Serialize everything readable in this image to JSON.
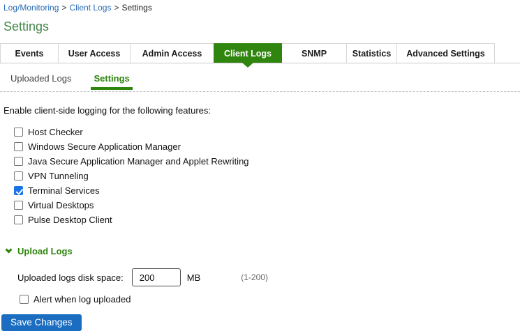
{
  "breadcrumb": {
    "separator": ">",
    "items": [
      {
        "label": "Log/Monitoring",
        "link": true
      },
      {
        "label": "Client Logs",
        "link": true
      },
      {
        "label": "Settings",
        "link": false
      }
    ]
  },
  "page": {
    "title": "Settings"
  },
  "tabs": {
    "items": [
      {
        "label": "Events",
        "active": false
      },
      {
        "label": "User Access",
        "active": false
      },
      {
        "label": "Admin Access",
        "active": false
      },
      {
        "label": "Client Logs",
        "active": true
      },
      {
        "label": "SNMP",
        "active": false
      },
      {
        "label": "Statistics",
        "active": false
      },
      {
        "label": "Advanced Settings",
        "active": false
      }
    ]
  },
  "subtabs": {
    "items": [
      {
        "label": "Uploaded Logs",
        "active": false
      },
      {
        "label": "Settings",
        "active": true
      }
    ]
  },
  "features": {
    "intro": "Enable client-side logging for the following features:",
    "items": [
      {
        "label": "Host Checker",
        "checked": false
      },
      {
        "label": "Windows Secure Application Manager",
        "checked": false
      },
      {
        "label": "Java Secure Application Manager and Applet Rewriting",
        "checked": false
      },
      {
        "label": "VPN Tunneling",
        "checked": false
      },
      {
        "label": "Terminal Services",
        "checked": true
      },
      {
        "label": "Virtual Desktops",
        "checked": false
      },
      {
        "label": "Pulse Desktop Client",
        "checked": false
      }
    ]
  },
  "upload_logs": {
    "section_title": "Upload Logs",
    "disk_space_label": "Uploaded logs disk space:",
    "disk_space_value": "200",
    "unit": "MB",
    "range_hint": "(1-200)",
    "alert": {
      "label": "Alert when log uploaded",
      "checked": false
    }
  },
  "actions": {
    "save_label": "Save Changes"
  },
  "colors": {
    "accent_green": "#2f850e",
    "title_green": "#428748",
    "link_blue": "#2b6cb5",
    "button_blue": "#1a6dc0",
    "checkbox_blue": "#1a73e8"
  }
}
